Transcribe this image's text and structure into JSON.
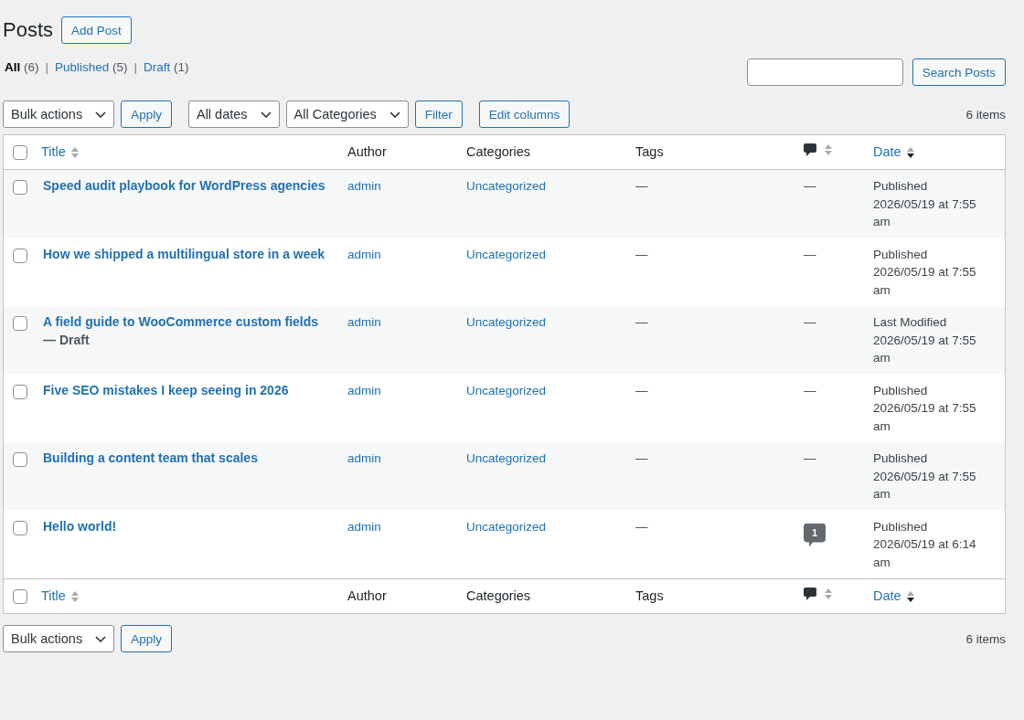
{
  "page": {
    "title": "Posts",
    "add_button": "Add Post"
  },
  "views": [
    {
      "label": "All",
      "count": "(6)",
      "selected": true,
      "separator": "|"
    },
    {
      "label": "Published",
      "count": "(5)",
      "selected": false,
      "separator": "|"
    },
    {
      "label": "Draft",
      "count": "(1)",
      "selected": false
    }
  ],
  "search": {
    "button": "Search Posts"
  },
  "top_tablenav": {
    "bulk_actions": {
      "dropdown": "Bulk actions",
      "button": "Apply"
    },
    "filters": {
      "dates": "All dates",
      "categories": "All Categories",
      "button": "Filter"
    },
    "edit_columns": "Edit columns",
    "item_count": "6 items"
  },
  "table": {
    "header": {
      "checked": false,
      "columns": [
        {
          "kind": "text",
          "label": "Title",
          "sortable": true,
          "sorted": false
        },
        {
          "kind": "text",
          "label": "Author",
          "sortable": false
        },
        {
          "kind": "text",
          "label": "Categories",
          "sortable": false
        },
        {
          "kind": "text",
          "label": "Tags",
          "sortable": false
        },
        {
          "kind": "comments",
          "sortable": true,
          "sorted": false
        },
        {
          "kind": "text",
          "label": "Date",
          "sortable": true,
          "sorted": true,
          "descending": true
        }
      ]
    },
    "rows": [
      {
        "checked": false,
        "title": "Speed audit playbook for WordPress agencies",
        "author": "admin",
        "category": "Uncategorized",
        "tags": "—",
        "comments": {
          "kind": "none",
          "text": "—"
        },
        "date_status": "Published",
        "date": "2026/05/19 at 7:55 am"
      },
      {
        "checked": false,
        "title": "How we shipped a multilingual store in a week",
        "author": "admin",
        "category": "Uncategorized",
        "tags": "—",
        "comments": {
          "kind": "none",
          "text": "—"
        },
        "date_status": "Published",
        "date": "2026/05/19 at 7:55 am"
      },
      {
        "checked": false,
        "title": "A field guide to WooCommerce custom fields",
        "post_state": "— Draft",
        "author": "admin",
        "category": "Uncategorized",
        "tags": "—",
        "comments": {
          "kind": "none",
          "text": "—"
        },
        "date_status": "Last Modified",
        "date": "2026/05/19 at 7:55 am"
      },
      {
        "checked": false,
        "title": "Five SEO mistakes I keep seeing in 2026",
        "author": "admin",
        "category": "Uncategorized",
        "tags": "—",
        "comments": {
          "kind": "none",
          "text": "—"
        },
        "date_status": "Published",
        "date": "2026/05/19 at 7:55 am"
      },
      {
        "checked": false,
        "title": "Building a content team that scales",
        "author": "admin",
        "category": "Uncategorized",
        "tags": "—",
        "comments": {
          "kind": "none",
          "text": "—"
        },
        "date_status": "Published",
        "date": "2026/05/19 at 7:55 am"
      },
      {
        "checked": false,
        "title": "Hello world!",
        "author": "admin",
        "category": "Uncategorized",
        "tags": "—",
        "comments": {
          "kind": "count",
          "text": "1"
        },
        "date_status": "Published",
        "date": "2026/05/19 at 6:14 am"
      }
    ],
    "footer": {
      "checked": false,
      "columns": [
        {
          "kind": "text",
          "label": "Title",
          "sortable": true,
          "sorted": false
        },
        {
          "kind": "text",
          "label": "Author",
          "sortable": false
        },
        {
          "kind": "text",
          "label": "Categories",
          "sortable": false
        },
        {
          "kind": "text",
          "label": "Tags",
          "sortable": false
        },
        {
          "kind": "comments",
          "sortable": true,
          "sorted": false
        },
        {
          "kind": "text",
          "label": "Date",
          "sortable": true,
          "sorted": true,
          "descending": true
        }
      ]
    }
  },
  "bottom_tablenav": {
    "bulk_actions": {
      "dropdown": "Bulk actions",
      "button": "Apply"
    },
    "item_count": "6 items"
  }
}
